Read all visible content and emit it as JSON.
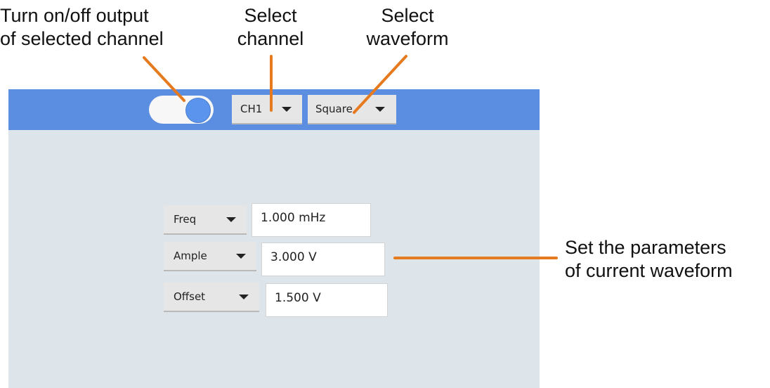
{
  "annotations": {
    "toggle": "Turn on/off output\nof selected channel",
    "channel": "Select\nchannel",
    "waveform": "Select\nwaveform",
    "params": "Set the parameters\nof current waveform"
  },
  "colors": {
    "accent_bar": "#5b8de0",
    "screen_bg": "#dde5ea",
    "leader_line": "#e57a1e"
  },
  "toolbar": {
    "output_toggle_on": true,
    "channel": "CH1",
    "waveform": "Square"
  },
  "params": [
    {
      "name": "Freq",
      "value": "1.000 mHz"
    },
    {
      "name": "Ample",
      "value": "3.000 V"
    },
    {
      "name": "Offset",
      "value": "1.500 V"
    }
  ]
}
